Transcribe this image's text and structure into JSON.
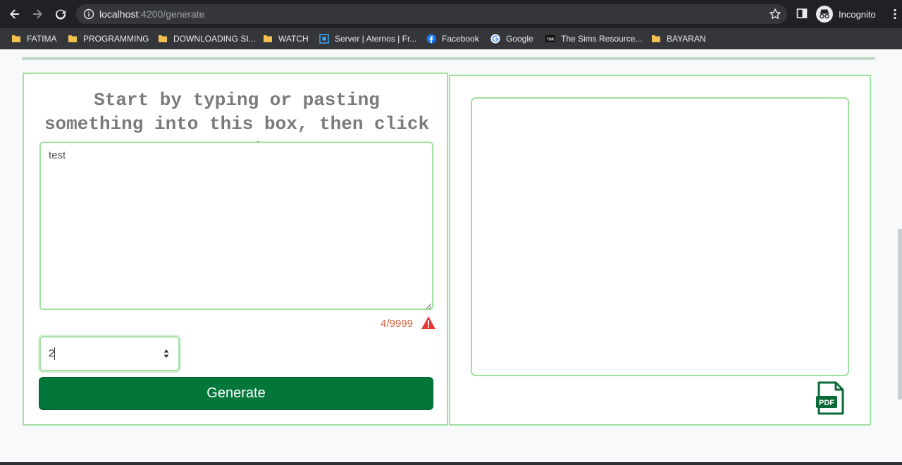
{
  "browser": {
    "url_host": "localhost",
    "url_path": ":4200/generate",
    "mode_label": "Incognito"
  },
  "bookmarks": [
    {
      "label": "FATIMA",
      "icon": "folder-icon"
    },
    {
      "label": "PROGRAMMING",
      "icon": "folder-icon"
    },
    {
      "label": "DOWNLOADING SI...",
      "icon": "folder-icon"
    },
    {
      "label": "WATCH",
      "icon": "folder-icon"
    },
    {
      "label": "Server | Aternos | Fr...",
      "icon": "aternos-icon"
    },
    {
      "label": "Facebook",
      "icon": "facebook-icon"
    },
    {
      "label": "Google",
      "icon": "google-icon"
    },
    {
      "label": "The Sims Resource...",
      "icon": "tsr-icon"
    },
    {
      "label": "BAYARAN",
      "icon": "folder-icon"
    }
  ],
  "generator": {
    "prompt": "Start by typing or pasting something into this box, then click generate.",
    "text_value": "test",
    "char_count": "4/9999",
    "number_value": "2",
    "generate_label": "Generate"
  },
  "output": {
    "pdf_label": "PDF"
  },
  "colors": {
    "accent_green": "#03773a",
    "border_green": "#9ee29e",
    "warning": "#d0603a"
  }
}
